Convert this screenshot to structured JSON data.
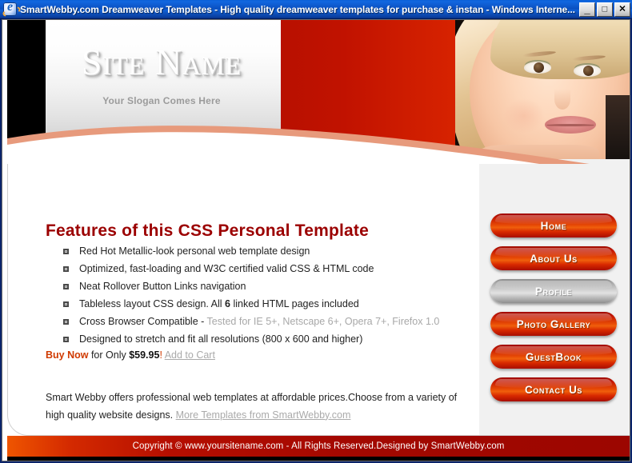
{
  "window": {
    "title": "SmartWebby.com Dreamweaver Templates - High quality dreamweaver templates for purchase & instan - Windows Interne...",
    "icon": "internet-explorer-icon",
    "buttons": {
      "minimize": "_",
      "maximize": "□",
      "close": "✕"
    }
  },
  "banner": {
    "site_name": "Site Name",
    "slogan": "Your Slogan Comes Here",
    "photo_alt": "smiling-blonde-woman-photo"
  },
  "main": {
    "heading": "Features of this CSS Personal Template",
    "features": [
      {
        "text": "Red Hot Metallic-look personal web template design"
      },
      {
        "text": "Optimized, fast-loading and W3C certified valid CSS & HTML code"
      },
      {
        "text": "Neat Rollover Button Links navigation"
      },
      {
        "pre": "Tableless layout CSS design. All ",
        "bold": "6",
        "post": " linked HTML pages included"
      },
      {
        "pre": "Cross Browser Compatible - ",
        "muted": "Tested for IE 5+, Netscape 6+, Opera 7+, Firefox 1.0"
      },
      {
        "text": "Designed to stretch and fit all resolutions (800 x 600 and higher)"
      }
    ],
    "buy": {
      "buy_now": "Buy Now",
      "for_only": " for Only ",
      "price": "$59.95",
      "bang": "!",
      "add_to_cart": "Add to Cart"
    },
    "paragraph": "Smart Webby offers professional web templates at affordable prices.Choose from a variety of high quality website designs. ",
    "more_link": "More Templates from SmartWebby.com"
  },
  "nav": {
    "items": [
      {
        "label": "Home",
        "state": "normal"
      },
      {
        "label": "About Us",
        "state": "normal"
      },
      {
        "label": "Profile",
        "state": "active"
      },
      {
        "label": "Photo Gallery",
        "state": "normal"
      },
      {
        "label": "GuestBook",
        "state": "normal"
      },
      {
        "label": "Contact Us",
        "state": "normal"
      }
    ]
  },
  "footer": {
    "text": "Copyright © www.yoursitename.com - All Rights Reserved.Designed by SmartWebby.com"
  },
  "colors": {
    "brand_red": "#c21500",
    "heading_red": "#9b0000",
    "accent_orange": "#d03a00",
    "gray_link": "#aaaaaa",
    "panel_gray": "#f1f1f1",
    "footer_red": "#a30800"
  }
}
